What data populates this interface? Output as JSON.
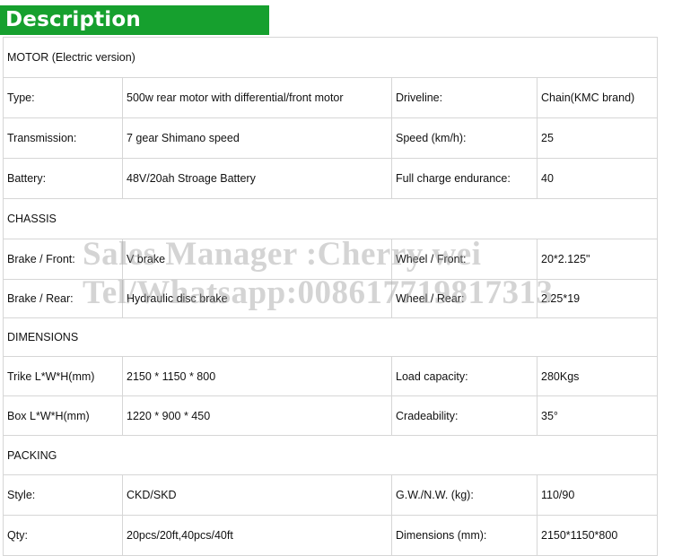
{
  "header": {
    "title": "Description",
    "color": "#16a02e"
  },
  "sections": {
    "motor": "MOTOR (Electric version)",
    "chassis": "CHASSIS",
    "dimensions": "DIMENSIONS",
    "packing": "PACKING"
  },
  "rows": {
    "type": {
      "l1": "Type:",
      "v1": "500w rear motor with differential/front motor",
      "l2": "Driveline:",
      "v2": "Chain(KMC brand)"
    },
    "transmission": {
      "l1": "Transmission:",
      "v1": "7 gear Shimano speed",
      "l2": "Speed (km/h):",
      "v2": "25"
    },
    "battery": {
      "l1": "Battery:",
      "v1": "48V/20ah  Stroage Battery",
      "l2": "Full charge endurance:",
      "v2": "40"
    },
    "brake_front": {
      "l1": "Brake / Front:",
      "v1": "V brake",
      "l2": "Wheel / Front:",
      "v2": "20*2.125\""
    },
    "brake_rear": {
      "l1": "Brake / Rear:",
      "v1": "Hydraulic disc brake",
      "l2": "Wheel / Rear:",
      "v2": "2.25*19"
    },
    "trike": {
      "l1": "Trike  L*W*H(mm)",
      "v1": "2150 * 1150 * 800",
      "l2": "Load capacity:",
      "v2": "280Kgs"
    },
    "box": {
      "l1": "Box  L*W*H(mm)",
      "v1": "1220 * 900 * 450",
      "l2": "Cradeability:",
      "v2": "35°"
    },
    "style": {
      "l1": "Style:",
      "v1": "CKD/SKD",
      "l2": "G.W./N.W. (kg):",
      "v2": "110/90"
    },
    "qty": {
      "l1": "Qty:",
      "v1": "20pcs/20ft,40pcs/40ft",
      "l2": "Dimensions (mm):",
      "v2": "2150*1150*800"
    }
  },
  "watermark": {
    "line1": "Sales Manager :Cherry wei",
    "line2": "Tel/Whatsapp:008617719817313"
  }
}
